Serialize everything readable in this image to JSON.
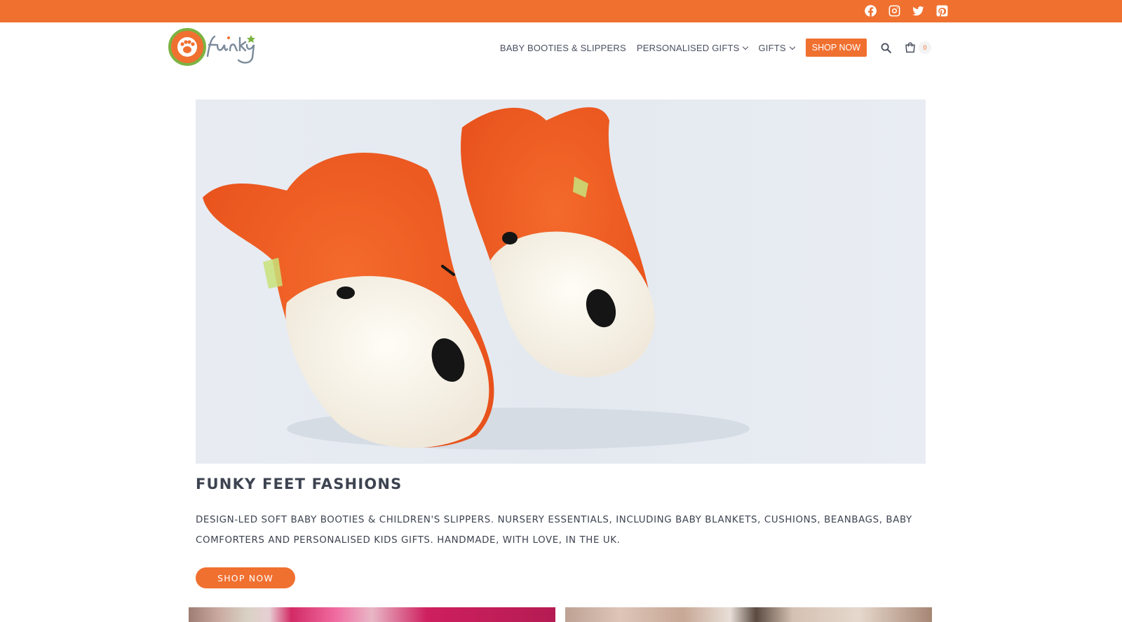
{
  "colors": {
    "accent": "#f07030",
    "text": "#3d4350",
    "nav_text": "#4b5060"
  },
  "topbar": {
    "social": [
      {
        "name": "facebook-icon"
      },
      {
        "name": "instagram-icon"
      },
      {
        "name": "twitter-icon"
      },
      {
        "name": "pinterest-icon"
      }
    ]
  },
  "header": {
    "logo_alt": "Funky Feet Fashions",
    "nav": {
      "item1": "BABY BOOTIES & SLIPPERS",
      "item2": "PERSONALISED GIFTS",
      "item3": "GIFTS",
      "cta": "SHOP NOW"
    },
    "cart_count": "0"
  },
  "main": {
    "hero_alt": "Fox baby booties",
    "title": "FUNKY FEET FASHIONS",
    "description": "DESIGN-LED SOFT BABY BOOTIES & CHILDREN'S SLIPPERS. NURSERY ESSENTIALS, INCLUDING BABY BLANKETS, CUSHIONS, BEANBAGS, BABY COMFORTERS AND PERSONALISED KIDS GIFTS. HANDMADE, WITH LOVE, IN THE UK.",
    "cta": "SHOP NOW"
  }
}
